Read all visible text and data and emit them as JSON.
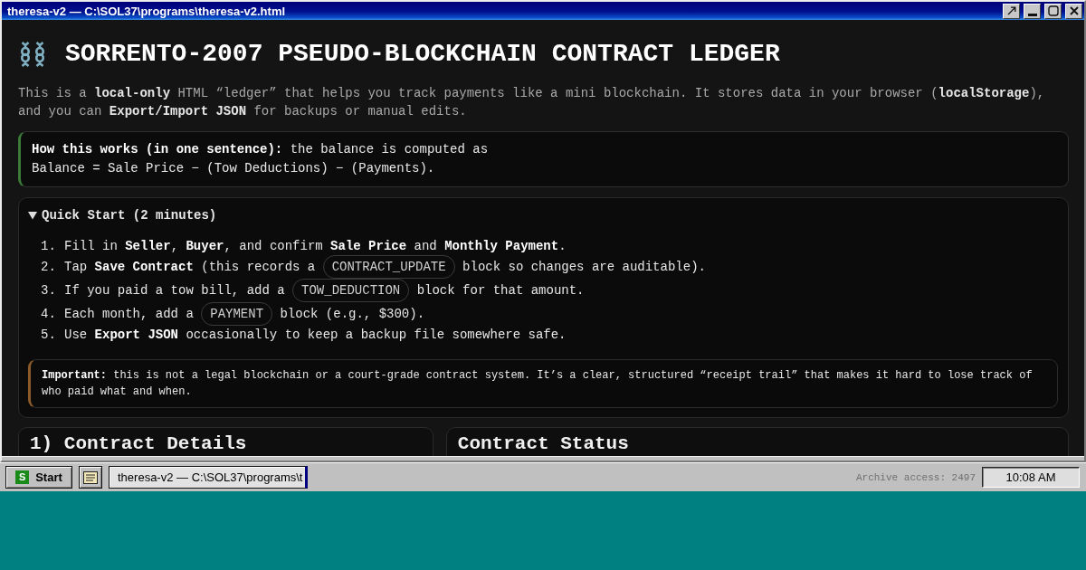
{
  "window": {
    "title": "theresa-v2 — C:\\SOL37\\programs\\theresa-v2.html",
    "controls": [
      {
        "kind": "popout"
      },
      {
        "kind": "minimize"
      },
      {
        "kind": "maximize"
      },
      {
        "kind": "close"
      }
    ]
  },
  "page": {
    "heading": "SORRENTO-2007 PSEUDO-BLOCKCHAIN CONTRACT LEDGER",
    "intro": "This is a **local-only** HTML “ledger” that helps you track payments like a mini blockchain. It stores data in your browser (**localStorage**), and you can **Export/Import JSON** for backups or manual edits.",
    "callout": {
      "kind": "tip",
      "text": "**How this works (in one sentence):** the balance is computed as\nBalance = Sale Price − (Tow Deductions) − (Payments)."
    },
    "quick_start": {
      "title": "Quick Start (2 minutes)",
      "expanded": true,
      "steps": [
        {
          "number": "1.",
          "parts": [
            {
              "kind": "text",
              "text": "Fill in **Seller**, **Buyer**, and confirm **Sale Price** and **Monthly Payment**."
            }
          ]
        },
        {
          "number": "2.",
          "parts": [
            {
              "kind": "text",
              "text": "Tap **Save Contract** (this records a "
            },
            {
              "kind": "chip",
              "text": "CONTRACT_UPDATE"
            },
            {
              "kind": "text",
              "text": " block so changes are auditable)."
            }
          ]
        },
        {
          "number": "3.",
          "parts": [
            {
              "kind": "text",
              "text": "If you paid a tow bill, add a "
            },
            {
              "kind": "chip",
              "text": "TOW_DEDUCTION"
            },
            {
              "kind": "text",
              "text": " block for that amount."
            }
          ]
        },
        {
          "number": "4.",
          "parts": [
            {
              "kind": "text",
              "text": "Each month, add a "
            },
            {
              "kind": "chip",
              "text": "PAYMENT"
            },
            {
              "kind": "text",
              "text": " block (e.g., $300)."
            }
          ]
        },
        {
          "number": "5.",
          "parts": [
            {
              "kind": "text",
              "text": "Use **Export JSON** occasionally to keep a backup file somewhere safe."
            }
          ]
        }
      ],
      "note": {
        "kind": "warning",
        "text": "**Important:** this is not a legal blockchain or a court-grade contract system. It’s a clear, structured “receipt trail” that makes it hard to lose track of who paid what and when."
      }
    },
    "panels": [
      {
        "title": "1) Contract Details"
      },
      {
        "title": "Contract Status"
      }
    ]
  },
  "taskbar": {
    "start": {
      "logo_letter": "S",
      "label": "Start"
    },
    "quick_launch": [
      {
        "kind": "document"
      }
    ],
    "tasks": [
      {
        "label": "theresa-v2 — C:\\SOL37\\programs\\t",
        "selected": true
      }
    ],
    "status_text": "Archive access: 2497",
    "clock": "10:08 AM"
  }
}
